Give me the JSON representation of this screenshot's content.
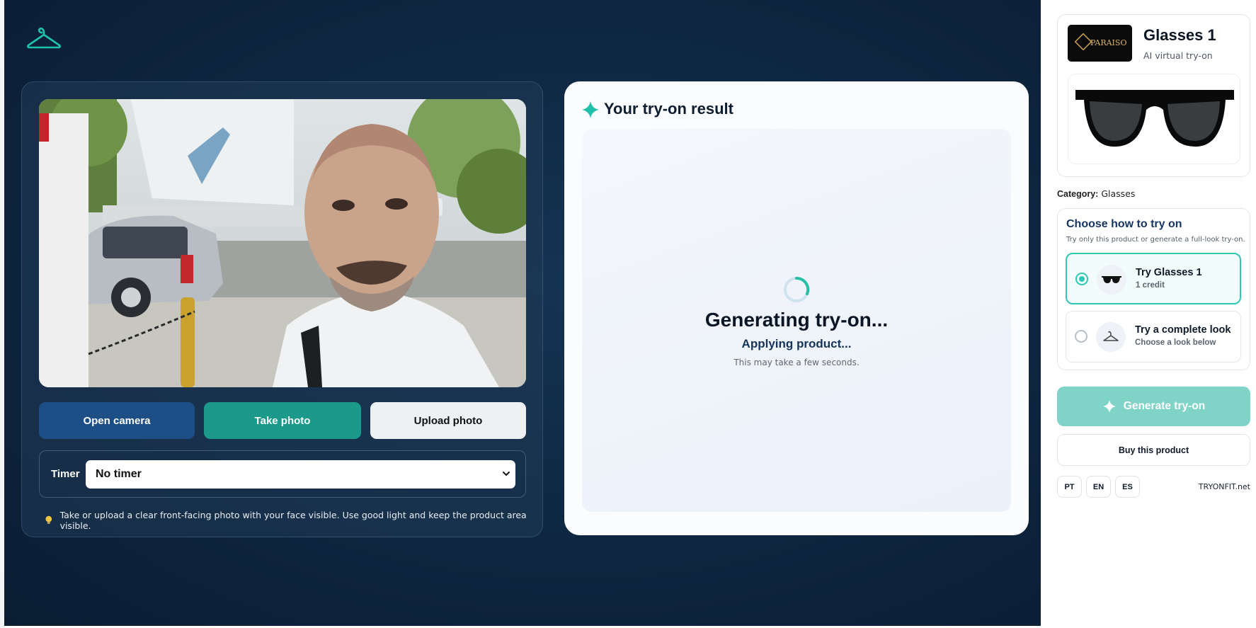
{
  "colors": {
    "accent_teal": "#1b9a8c",
    "accent_blue": "#1d4f86",
    "background_navy": "#0e2640"
  },
  "header": {
    "logo_icon": "hanger-icon"
  },
  "camera": {
    "open_camera_label": "Open camera",
    "take_photo_label": "Take photo",
    "upload_photo_label": "Upload photo",
    "timer_label": "Timer",
    "timer_value": "No timer",
    "hint_icon": "lightbulb-icon",
    "hint": "Take or upload a clear front-facing photo with your face visible. Use good light and keep the product area visible."
  },
  "result": {
    "title": "Your try-on result",
    "status_title": "Generating try-on...",
    "status_sub": "Applying product...",
    "status_note": "This may take a few seconds."
  },
  "sidebar": {
    "brand_logo_text": "PARAISO",
    "product_name": "Glasses 1",
    "product_subtitle": "AI virtual try-on",
    "category_label": "Category:",
    "category_value": "Glasses",
    "choose_title": "Choose how to try on",
    "choose_sub": "Try only this product or generate a full-look try-on.",
    "options": [
      {
        "title": "Try Glasses 1",
        "sub": "1 credit",
        "selected": true,
        "icon": "sunglasses-icon"
      },
      {
        "title": "Try a complete look",
        "sub": "Choose a look below",
        "selected": false,
        "icon": "hanger-icon"
      }
    ],
    "generate_label": "Generate try-on",
    "buy_label": "Buy this product",
    "languages": [
      "PT",
      "EN",
      "ES"
    ],
    "site": "TRYONFIT.net"
  }
}
